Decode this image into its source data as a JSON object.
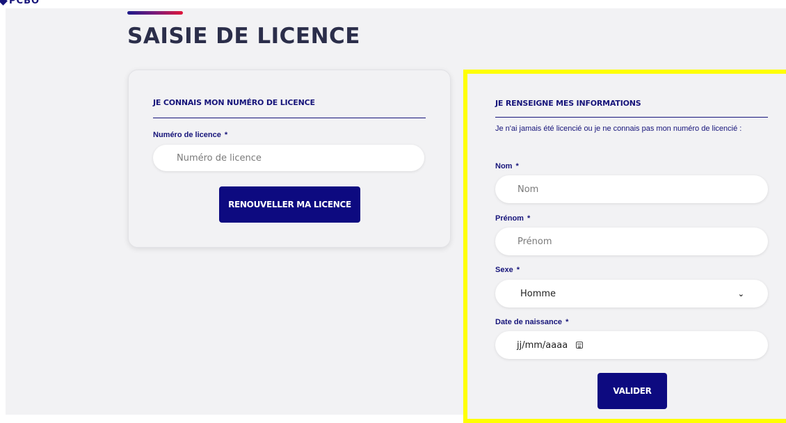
{
  "logo": {
    "text": "PCBO"
  },
  "page": {
    "title": "SAISIE DE LICENCE"
  },
  "license_card": {
    "heading": "JE CONNAIS MON NUMÉRO DE LICENCE",
    "label": "Numéro de licence",
    "required_mark": "*",
    "placeholder": "Numéro de licence",
    "button": "RENOUVELLER MA LICENCE"
  },
  "info_card": {
    "heading": "JE RENSEIGNE MES INFORMATIONS",
    "intro": "Je n'ai jamais été licencié ou je ne connais pas mon numéro de licencié :",
    "nom_label": "Nom",
    "nom_placeholder": "Nom",
    "prenom_label": "Prénom",
    "prenom_placeholder": "Prénom",
    "sexe_label": "Sexe",
    "sexe_value": "Homme",
    "dob_label": "Date de naissance",
    "dob_placeholder": "jj/mm/aaaa",
    "required_mark": "*",
    "button": "VALIDER"
  },
  "colors": {
    "primary": "#0d0a80",
    "label": "#16147a",
    "title": "#2b2e4a",
    "highlight": "#ffff00",
    "background": "#f2f2f4"
  },
  "icons": [
    "map-pin-logo-icon",
    "chevron-down-icon",
    "calendar-icon"
  ]
}
